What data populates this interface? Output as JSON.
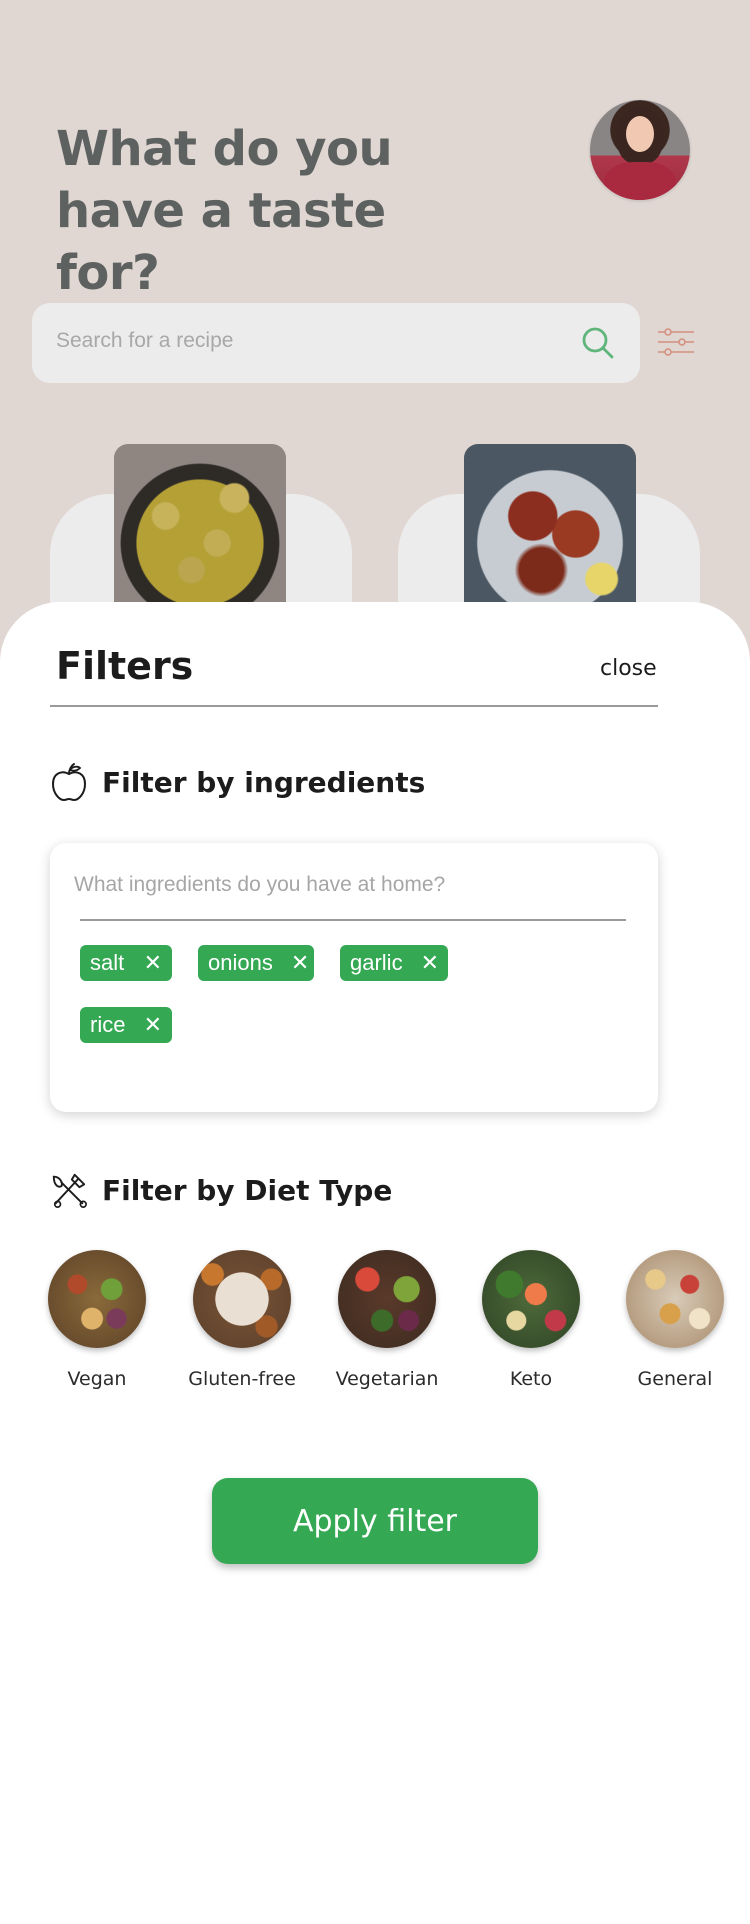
{
  "header": {
    "headline_line1": "What do you",
    "headline_line2": "have a taste for?"
  },
  "search": {
    "placeholder": "Search for a recipe",
    "icon": "search-icon",
    "filter_icon": "sliders-icon"
  },
  "recipes": [
    {
      "image": "curry-meatballs-image"
    },
    {
      "image": "grilled-chicken-image"
    }
  ],
  "filters": {
    "title": "Filters",
    "close_label": "close",
    "ingredients": {
      "heading": "Filter by ingredients",
      "icon": "apple-icon",
      "placeholder": "What ingredients do you have at home?",
      "chips": [
        "salt",
        "onions",
        "garlic",
        "rice"
      ],
      "remove_symbol": "✕"
    },
    "diet": {
      "heading": "Filter by Diet Type",
      "icon": "utensils-icon",
      "types": [
        "Vegan",
        "Gluten-free",
        "Vegetarian",
        "Keto",
        "General"
      ]
    },
    "apply_label": "Apply filter"
  },
  "colors": {
    "accent": "#34a853",
    "background": "#e0d7d3",
    "filter_icon": "#d4917f"
  }
}
